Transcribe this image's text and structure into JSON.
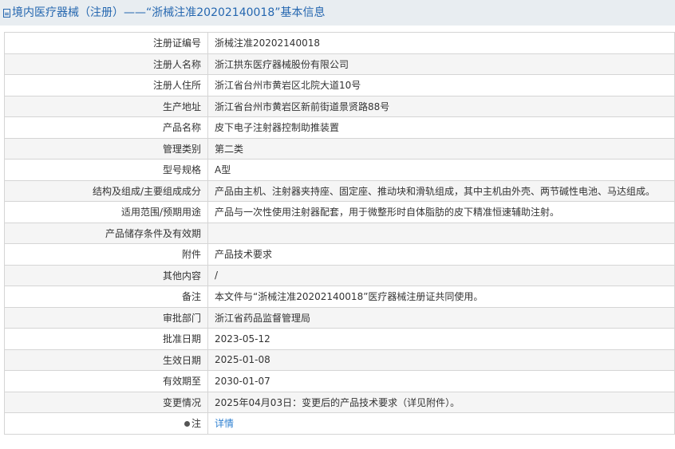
{
  "title": "境内医疗器械（注册）——“浙械注准20202140018”基本信息",
  "rows": [
    {
      "label": "注册证编号",
      "value": "浙械注准20202140018"
    },
    {
      "label": "注册人名称",
      "value": "浙江拱东医疗器械股份有限公司"
    },
    {
      "label": "注册人住所",
      "value": "浙江省台州市黄岩区北院大道10号"
    },
    {
      "label": "生产地址",
      "value": "浙江省台州市黄岩区新前街道景贤路88号"
    },
    {
      "label": "产品名称",
      "value": "皮下电子注射器控制助推装置"
    },
    {
      "label": "管理类别",
      "value": "第二类"
    },
    {
      "label": "型号规格",
      "value": "A型"
    },
    {
      "label": "结构及组成/主要组成成分",
      "value": "产品由主机、注射器夹持座、固定座、推动块和滑轨组成，其中主机由外壳、两节碱性电池、马达组成。"
    },
    {
      "label": "适用范围/预期用途",
      "value": "产品与一次性使用注射器配套，用于微整形时自体脂肪的皮下精准恒速辅助注射。"
    },
    {
      "label": "产品储存条件及有效期",
      "value": ""
    },
    {
      "label": "附件",
      "value": "产品技术要求"
    },
    {
      "label": "其他内容",
      "value": "/"
    },
    {
      "label": "备注",
      "value": "本文件与“浙械注准20202140018”医疗器械注册证共同使用。"
    },
    {
      "label": "审批部门",
      "value": "浙江省药品监督管理局"
    },
    {
      "label": "批准日期",
      "value": "2023-05-12"
    },
    {
      "label": "生效日期",
      "value": "2025-01-08"
    },
    {
      "label": "有效期至",
      "value": "2030-01-07"
    },
    {
      "label": "变更情况",
      "value": "2025年04月03日：变更后的产品技术要求（详见附件）。"
    }
  ],
  "note": {
    "label": "注",
    "link": "详情"
  }
}
